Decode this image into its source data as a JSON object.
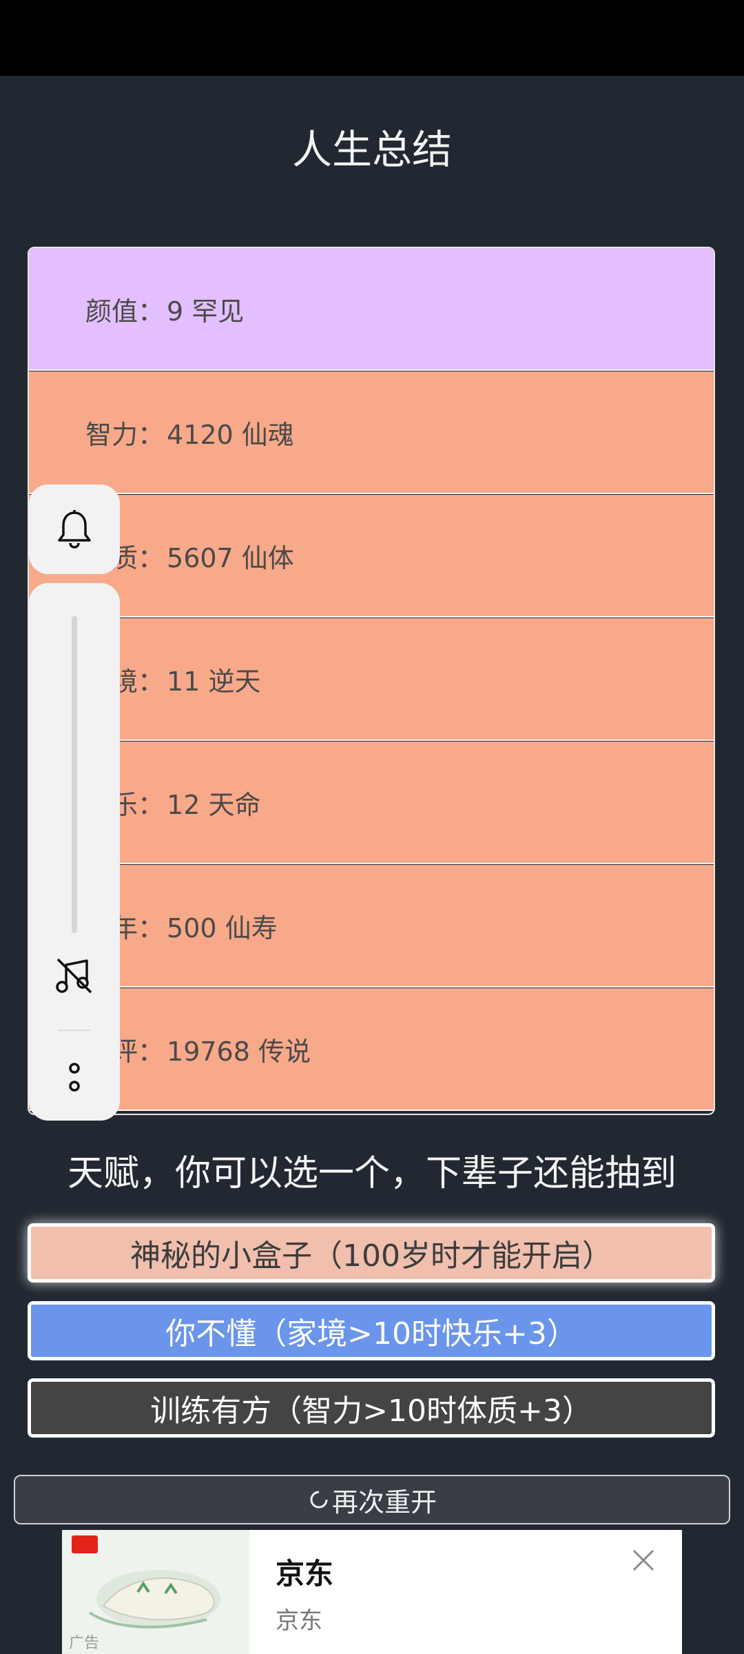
{
  "page": {
    "title": "人生总结"
  },
  "stats": [
    {
      "label": "颜值：",
      "value": "9 罕见"
    },
    {
      "label": "智力：",
      "value": "4120 仙魂"
    },
    {
      "label": "体质：",
      "value": "5607 仙体"
    },
    {
      "label": "家境：",
      "value": "11 逆天"
    },
    {
      "label": "快乐：",
      "value": "12 天命"
    },
    {
      "label": "享年：",
      "value": "500 仙寿"
    },
    {
      "label": "总评：",
      "value": "19768 传说"
    }
  ],
  "talents": {
    "prompt": "天赋，你可以选一个，下辈子还能抽到",
    "options": [
      "神秘的小盒子（100岁时才能开启）",
      "你不懂（家境>10时快乐+3）",
      "训练有方（智力>10时体质+3）"
    ]
  },
  "restart": {
    "label": "再次重开"
  },
  "floating": {
    "icons": [
      "bell-icon",
      "music-off-icon",
      "more-icon"
    ]
  },
  "ad": {
    "title": "京东",
    "subtitle": "京东",
    "tag": "广告"
  },
  "colors": {
    "background": "#222831",
    "stat_purple": "#e3bfff",
    "stat_orange": "#f7a989",
    "talent_selected": "#f0bfae",
    "talent_blue": "#6a95ea",
    "talent_dark": "#444444"
  }
}
